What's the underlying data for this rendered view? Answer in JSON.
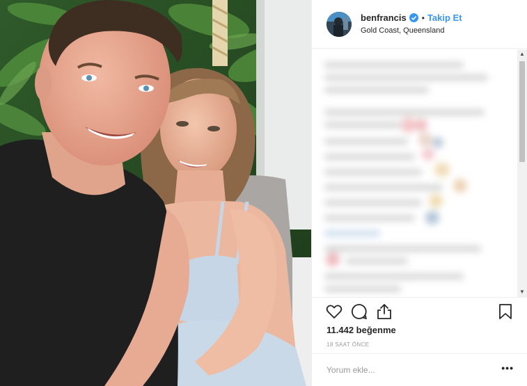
{
  "header": {
    "username": "benfrancis",
    "separator": "•",
    "follow_label": "Takip Et",
    "location": "Gold Coast, Queensland"
  },
  "post": {
    "likes_text": "11.442 beğenme",
    "time_ago": "18 SAAT ÖNCE"
  },
  "comment_box": {
    "placeholder": "Yorum ekle...",
    "more_label": "•••"
  },
  "icons": {
    "like": "heart-icon",
    "comment": "speech-bubble-icon",
    "share": "share-icon",
    "save": "bookmark-icon",
    "verified": "verified-badge-icon"
  },
  "colors": {
    "accent": "#3897f0",
    "text": "#262626",
    "muted": "#999999",
    "border": "#efefef"
  }
}
